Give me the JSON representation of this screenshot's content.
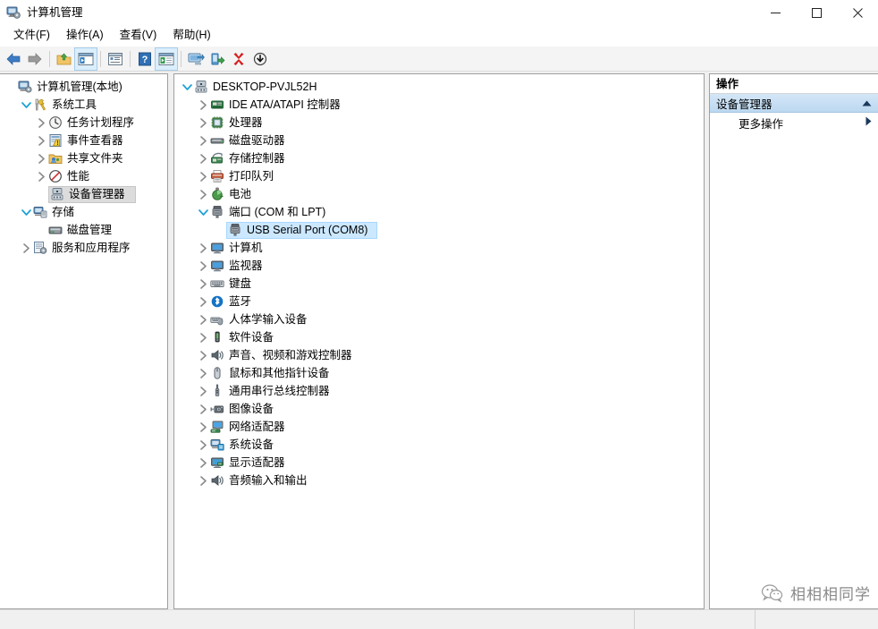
{
  "window": {
    "title": "计算机管理",
    "icon": "computer-management-icon",
    "controls": {
      "minimize": "—",
      "maximize": "□",
      "close": "✕"
    }
  },
  "menubar": {
    "items": [
      {
        "label": "文件(F)",
        "name": "menu-file"
      },
      {
        "label": "操作(A)",
        "name": "menu-action"
      },
      {
        "label": "查看(V)",
        "name": "menu-view"
      },
      {
        "label": "帮助(H)",
        "name": "menu-help"
      }
    ]
  },
  "toolbar": {
    "buttons": [
      {
        "icon": "back-arrow-icon",
        "name": "toolbar-back"
      },
      {
        "icon": "forward-arrow-icon",
        "name": "toolbar-forward"
      },
      {
        "icon": "up-folder-icon",
        "name": "toolbar-up-folder"
      },
      {
        "icon": "show-hide-tree-icon",
        "name": "toolbar-show-console-tree"
      },
      {
        "icon": "properties-icon",
        "name": "toolbar-properties"
      },
      {
        "icon": "help-icon",
        "name": "toolbar-help"
      },
      {
        "icon": "show-action-pane-icon",
        "name": "toolbar-show-action-pane"
      },
      {
        "icon": "scan-hardware-icon",
        "name": "toolbar-scan-hardware-changes"
      },
      {
        "icon": "update-driver-icon",
        "name": "toolbar-update-driver"
      },
      {
        "icon": "uninstall-device-icon",
        "name": "toolbar-uninstall-device"
      },
      {
        "icon": "disable-device-icon",
        "name": "toolbar-disable-device"
      }
    ]
  },
  "console_tree": {
    "items": [
      {
        "label": "计算机管理(本地)",
        "indent": 0,
        "twisty": "none",
        "icon": "computer-management-icon",
        "selected": false
      },
      {
        "label": "系统工具",
        "indent": 1,
        "twisty": "expanded",
        "icon": "system-tools-icon",
        "selected": false
      },
      {
        "label": "任务计划程序",
        "indent": 2,
        "twisty": "collapsed",
        "icon": "task-scheduler-icon",
        "selected": false
      },
      {
        "label": "事件查看器",
        "indent": 2,
        "twisty": "collapsed",
        "icon": "event-viewer-icon",
        "selected": false
      },
      {
        "label": "共享文件夹",
        "indent": 2,
        "twisty": "collapsed",
        "icon": "shared-folders-icon",
        "selected": false
      },
      {
        "label": "性能",
        "indent": 2,
        "twisty": "collapsed",
        "icon": "performance-icon",
        "selected": false
      },
      {
        "label": "设备管理器",
        "indent": 2,
        "twisty": "none",
        "icon": "device-manager-icon",
        "selected": true
      },
      {
        "label": "存储",
        "indent": 1,
        "twisty": "expanded",
        "icon": "storage-icon",
        "selected": false
      },
      {
        "label": "磁盘管理",
        "indent": 2,
        "twisty": "none",
        "icon": "disk-management-icon",
        "selected": false
      },
      {
        "label": "服务和应用程序",
        "indent": 1,
        "twisty": "collapsed",
        "icon": "services-apps-icon",
        "selected": false
      }
    ]
  },
  "device_tree": {
    "items": [
      {
        "label": "DESKTOP-PVJL52H",
        "indent": 0,
        "twisty": "expanded",
        "icon": "computer-icon",
        "selected": false
      },
      {
        "label": "IDE ATA/ATAPI 控制器",
        "indent": 1,
        "twisty": "collapsed",
        "icon": "ide-controller-icon",
        "selected": false
      },
      {
        "label": "处理器",
        "indent": 1,
        "twisty": "collapsed",
        "icon": "processor-icon",
        "selected": false
      },
      {
        "label": "磁盘驱动器",
        "indent": 1,
        "twisty": "collapsed",
        "icon": "disk-drive-icon",
        "selected": false
      },
      {
        "label": "存储控制器",
        "indent": 1,
        "twisty": "collapsed",
        "icon": "storage-controller-icon",
        "selected": false
      },
      {
        "label": "打印队列",
        "indent": 1,
        "twisty": "collapsed",
        "icon": "print-queue-icon",
        "selected": false
      },
      {
        "label": "电池",
        "indent": 1,
        "twisty": "collapsed",
        "icon": "battery-icon",
        "selected": false
      },
      {
        "label": "端口 (COM 和 LPT)",
        "indent": 1,
        "twisty": "expanded",
        "icon": "ports-icon",
        "selected": false
      },
      {
        "label": "USB Serial Port (COM8)",
        "indent": 2,
        "twisty": "none",
        "icon": "serial-port-icon",
        "selected": true
      },
      {
        "label": "计算机",
        "indent": 1,
        "twisty": "collapsed",
        "icon": "computer-monitor-icon",
        "selected": false
      },
      {
        "label": "监视器",
        "indent": 1,
        "twisty": "collapsed",
        "icon": "monitor-icon",
        "selected": false
      },
      {
        "label": "键盘",
        "indent": 1,
        "twisty": "collapsed",
        "icon": "keyboard-icon",
        "selected": false
      },
      {
        "label": "蓝牙",
        "indent": 1,
        "twisty": "collapsed",
        "icon": "bluetooth-icon",
        "selected": false
      },
      {
        "label": "人体学输入设备",
        "indent": 1,
        "twisty": "collapsed",
        "icon": "hid-device-icon",
        "selected": false
      },
      {
        "label": "软件设备",
        "indent": 1,
        "twisty": "collapsed",
        "icon": "software-device-icon",
        "selected": false
      },
      {
        "label": "声音、视频和游戏控制器",
        "indent": 1,
        "twisty": "collapsed",
        "icon": "sound-video-game-icon",
        "selected": false
      },
      {
        "label": "鼠标和其他指针设备",
        "indent": 1,
        "twisty": "collapsed",
        "icon": "mouse-icon",
        "selected": false
      },
      {
        "label": "通用串行总线控制器",
        "indent": 1,
        "twisty": "collapsed",
        "icon": "usb-controller-icon",
        "selected": false
      },
      {
        "label": "图像设备",
        "indent": 1,
        "twisty": "collapsed",
        "icon": "imaging-device-icon",
        "selected": false
      },
      {
        "label": "网络适配器",
        "indent": 1,
        "twisty": "collapsed",
        "icon": "network-adapter-icon",
        "selected": false
      },
      {
        "label": "系统设备",
        "indent": 1,
        "twisty": "collapsed",
        "icon": "system-device-icon",
        "selected": false
      },
      {
        "label": "显示适配器",
        "indent": 1,
        "twisty": "collapsed",
        "icon": "display-adapter-icon",
        "selected": false
      },
      {
        "label": "音频输入和输出",
        "indent": 1,
        "twisty": "collapsed",
        "icon": "audio-io-icon",
        "selected": false
      }
    ]
  },
  "actions_pane": {
    "title": "操作",
    "group_header": "设备管理器",
    "group_collapse_icon": "chevron-up-icon",
    "items": [
      {
        "label": "更多操作",
        "name": "action-more-actions",
        "submenu_icon": "chevron-right-icon"
      }
    ]
  },
  "statusbar": {
    "main": "",
    "segment1": "",
    "segment2": ""
  },
  "watermark": {
    "text": "相相相同学",
    "logo": "wechat-logo-icon"
  },
  "colors": {
    "selection_blue": "#cce8ff",
    "selection_blue_border": "#a8d8ff",
    "selection_grey": "#dcdcdc",
    "action_header_top": "#d4e6f7",
    "action_header_bottom": "#bcd8f0",
    "toolbar_bg": "#f4f4f4",
    "pane_border": "#9f9f9f",
    "twisty_expanded": "#1ba1d6",
    "twisty_collapsed": "#8a8a8a"
  }
}
